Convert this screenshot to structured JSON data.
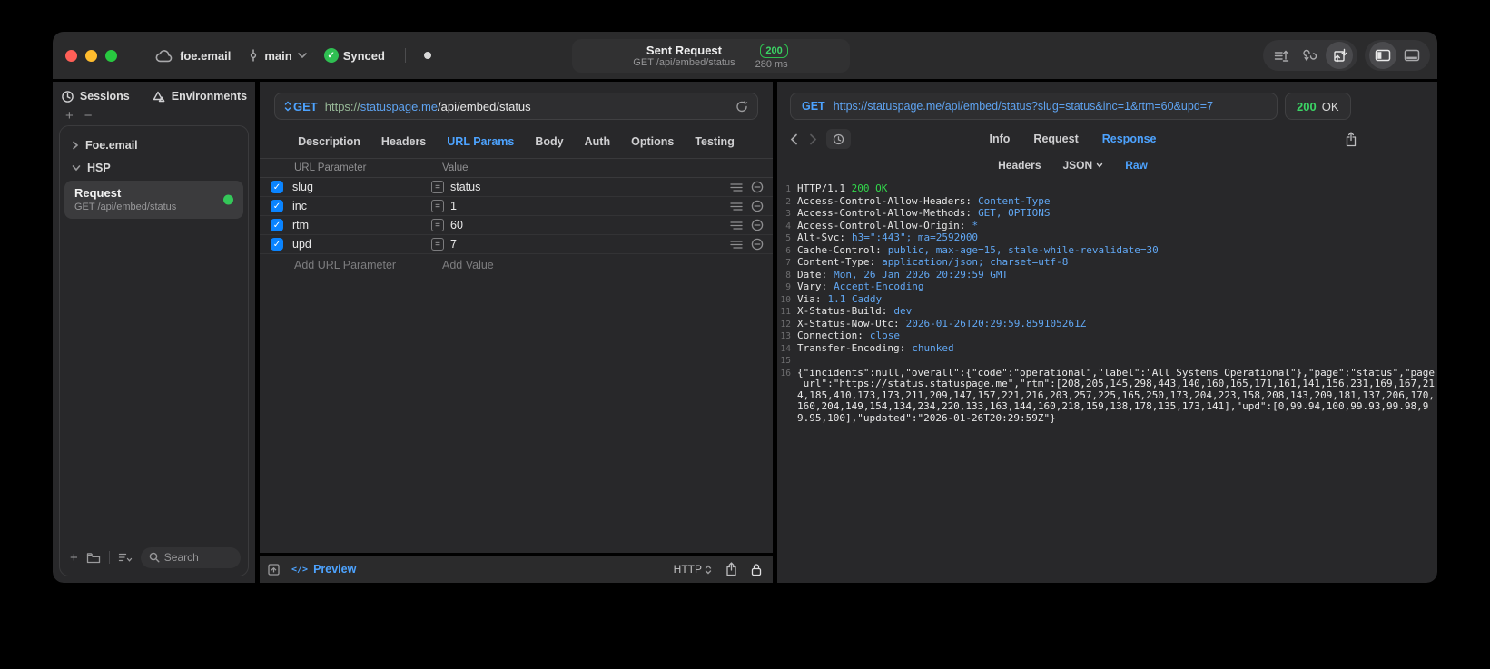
{
  "colors": {
    "accent_blue": "#4da3ff",
    "value_blue": "#61a7f3",
    "green": "#32d74b",
    "checkbox_blue": "#0a84ff",
    "badge_green": "#2fbf4f"
  },
  "icons": [
    "cloud-icon",
    "git-commit-icon",
    "chevron-down-icon",
    "synced-check-icon",
    "unsaved-dot",
    "import-icon",
    "code-generator-icon",
    "send-request-icon",
    "left-panel-icon",
    "bottom-panel-icon",
    "history-icon",
    "environments-icon",
    "chevron-right-icon",
    "plus-icon",
    "minus-icon",
    "folder-icon",
    "sort-icon",
    "search-icon",
    "method-updown-icon",
    "reload-icon",
    "equals-icon",
    "reorder-icon",
    "remove-icon",
    "expand-editor-icon",
    "code-icon",
    "share-icon",
    "lock-icon",
    "back-icon",
    "forward-icon"
  ],
  "titlebar": {
    "project": "foe.email",
    "branch": "main",
    "sync_label": "Synced",
    "center": {
      "title": "Sent Request",
      "subtitle": "GET /api/embed/status",
      "status_code": "200",
      "duration": "280 ms"
    }
  },
  "sidebar": {
    "tabs": {
      "sessions": "Sessions",
      "environments": "Environments"
    },
    "add_label": "+",
    "remove_label": "−",
    "tree": {
      "item1": "Foe.email",
      "item2": "HSP"
    },
    "request_item": {
      "title": "Request",
      "subtitle": "GET /api/embed/status"
    },
    "search_placeholder": "Search"
  },
  "request_panel": {
    "method": "GET",
    "url": {
      "scheme": "https://",
      "host": "statuspage.me",
      "path": "/api/embed/status"
    },
    "tabs": [
      {
        "label": "Description",
        "active": false
      },
      {
        "label": "Headers",
        "active": false
      },
      {
        "label": "URL Params",
        "active": true
      },
      {
        "label": "Body",
        "active": false
      },
      {
        "label": "Auth",
        "active": false
      },
      {
        "label": "Options",
        "active": false
      },
      {
        "label": "Testing",
        "active": false
      }
    ],
    "table": {
      "columns": {
        "name": "URL Parameter",
        "value": "Value"
      },
      "rows": [
        {
          "name": "slug",
          "value": "status"
        },
        {
          "name": "inc",
          "value": "1"
        },
        {
          "name": "rtm",
          "value": "60"
        },
        {
          "name": "upd",
          "value": "7"
        }
      ],
      "add_name": "Add URL Parameter",
      "add_value": "Add Value"
    },
    "footer": {
      "preview": "Preview",
      "code_glyph": "</>",
      "protocol": "HTTP"
    }
  },
  "response_panel": {
    "method": "GET",
    "url": "https://statuspage.me/api/embed/status?slug=status&inc=1&rtm=60&upd=7",
    "status_code": "200",
    "status_ok": "OK",
    "tabs": {
      "info": "Info",
      "request": "Request",
      "response": "Response"
    },
    "subtabs": {
      "headers": "Headers",
      "json": "JSON",
      "raw": "Raw"
    },
    "status_line": {
      "n": "1",
      "protocol": "HTTP/1.1 ",
      "status": "200 OK"
    },
    "headers": [
      {
        "n": "2",
        "key": "Access-Control-Allow-Headers:",
        "value": "Content-Type"
      },
      {
        "n": "3",
        "key": "Access-Control-Allow-Methods:",
        "value": "GET, OPTIONS"
      },
      {
        "n": "4",
        "key": "Access-Control-Allow-Origin:",
        "value": "*"
      },
      {
        "n": "5",
        "key": "Alt-Svc:",
        "value": "h3=\":443\"; ma=2592000"
      },
      {
        "n": "6",
        "key": "Cache-Control:",
        "value": "public, max-age=15, stale-while-revalidate=30"
      },
      {
        "n": "7",
        "key": "Content-Type:",
        "value": "application/json; charset=utf-8"
      },
      {
        "n": "8",
        "key": "Date:",
        "value": "Mon, 26 Jan 2026 20:29:59 GMT"
      },
      {
        "n": "9",
        "key": "Vary:",
        "value": "Accept-Encoding"
      },
      {
        "n": "10",
        "key": "Via:",
        "value": "1.1 Caddy"
      },
      {
        "n": "11",
        "key": "X-Status-Build:",
        "value": "dev"
      },
      {
        "n": "12",
        "key": "X-Status-Now-Utc:",
        "value": "2026-01-26T20:29:59.859105261Z"
      },
      {
        "n": "13",
        "key": "Connection:",
        "value": "close"
      },
      {
        "n": "14",
        "key": "Transfer-Encoding:",
        "value": "chunked"
      }
    ],
    "blank_line_n": "15",
    "body_line_n": "16",
    "body": "{\"incidents\":null,\"overall\":{\"code\":\"operational\",\"label\":\"All Systems Operational\"},\"page\":\"status\",\"page_url\":\"https://status.statuspage.me\",\"rtm\":[208,205,145,298,443,140,160,165,171,161,141,156,231,169,167,214,185,410,173,173,211,209,147,157,221,216,203,257,225,165,250,173,204,223,158,208,143,209,181,137,206,170,160,204,149,154,134,234,220,133,163,144,160,218,159,138,178,135,173,141],\"upd\":[0,99.94,100,99.93,99.98,99.95,100],\"updated\":\"2026-01-26T20:29:59Z\"}"
  }
}
